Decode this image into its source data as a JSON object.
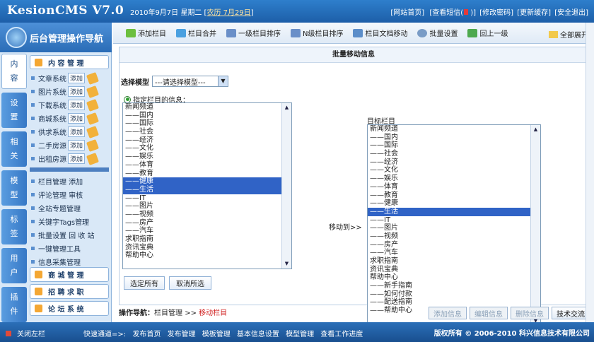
{
  "header": {
    "logo": "KesionCMS V7.0",
    "date": "2010年9月7日 星期二",
    "lunar_open": "[",
    "lunar": "农历 7月29日",
    "lunar_close": "]",
    "links": [
      "[网站首页]",
      "[查看短信(",
      ")]",
      "[修改密码]",
      "[更新缓存]",
      "[安全退出]"
    ]
  },
  "nav": {
    "title": "后台管理操作导航",
    "tabs": [
      {
        "top": "内",
        "bottom": "容",
        "active": true
      },
      {
        "top": "设",
        "bottom": "置"
      },
      {
        "top": "相",
        "bottom": "关"
      },
      {
        "top": "模",
        "bottom": "型"
      },
      {
        "top": "标",
        "bottom": "签"
      },
      {
        "top": "用",
        "bottom": "户"
      },
      {
        "top": "插",
        "bottom": "件"
      }
    ],
    "section_content": "内 容 管 理",
    "add_label": "添加",
    "systems": [
      "文章系统",
      "图片系统",
      "下载系统",
      "商城系统",
      "供求系统",
      "二手房源",
      "出租房源"
    ],
    "tools": [
      "栏目管理 添加",
      "评论管理 审核",
      "全站专题管理",
      "关键字Tags管理",
      "批量设置 回 收 站",
      "一键管理工具",
      "信息采集管理"
    ],
    "sections_bottom": [
      "商 城 管 理",
      "招 聘 求 职",
      "论 坛 系 统"
    ]
  },
  "toolbar": {
    "items": [
      "添加栏目",
      "栏目合并",
      "一级栏目排序",
      "N级栏目排序",
      "栏目文档移动",
      "批量设置",
      "回上一级"
    ],
    "expand": "全部展开"
  },
  "panel": {
    "title": "批量移动信息",
    "select_model_label": "选择模型",
    "select_model_value": "---请选择模型---",
    "radio_label": "指定栏目的信息：",
    "target_label": "目标栏目",
    "move_to": "移动到>>",
    "select_all": "选定所有",
    "deselect_all": "取消所选",
    "source_list": [
      "新闻频道",
      "——国内",
      "——国际",
      "——社会",
      "——经济",
      "——文化",
      "——娱乐",
      "——体育",
      "——教育",
      "——健康",
      "——生活",
      "——IT",
      "——图片",
      "——视频",
      "——房产",
      "——汽车",
      "求职指南",
      "资讯宝典",
      "帮助中心"
    ],
    "source_selected": [
      9,
      10
    ],
    "target_list": [
      "新闻频道",
      "——国内",
      "——国际",
      "——社会",
      "——经济",
      "——文化",
      "——娱乐",
      "——体育",
      "——教育",
      "——健康",
      "——生活",
      "——IT",
      "——图片",
      "——视频",
      "——房产",
      "——汽车",
      "求职指南",
      "资讯宝典",
      "帮助中心",
      "——新手指南",
      "——如何付款",
      "——配送指南",
      "——帮助中心"
    ],
    "target_selected": [
      10
    ]
  },
  "footer_nav": {
    "label": "操作导航：",
    "path": "栏目管理",
    "sep": ">>",
    "current": "移动栏目",
    "buttons": [
      "添加信息",
      "编辑信息",
      "删除信息",
      "技术交流"
    ]
  },
  "status": {
    "close": "关闭左栏",
    "quick_label": "快速通道=>:",
    "quick_links": [
      "发布首页",
      "发布管理",
      "模板管理",
      "基本信息设置",
      "模型管理",
      "查看工作进度"
    ],
    "copyright": "版权所有 © 2006-2010 科兴信息技术有限公司"
  }
}
